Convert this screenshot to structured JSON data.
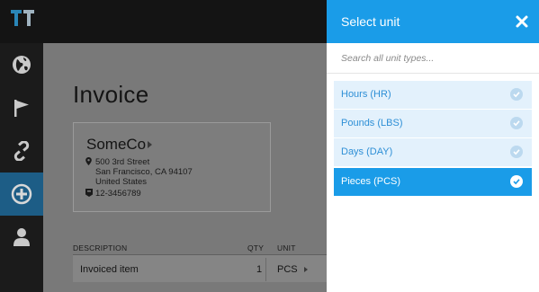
{
  "app": {
    "invoice_title": "Invoice",
    "company": {
      "name": "SomeCo",
      "address_lines": [
        "500 3rd Street",
        "San Francisco, CA 94107",
        "United States"
      ],
      "phone": "12-3456789"
    },
    "table": {
      "headers": [
        "DESCRIPTION",
        "QTY",
        "UNIT"
      ],
      "rows": [
        {
          "description": "Invoiced item",
          "qty": "1",
          "unit": "PCS"
        }
      ]
    },
    "nav": [
      "globe-icon",
      "flag-icon",
      "link-icon",
      "add-icon",
      "user-icon"
    ]
  },
  "panel": {
    "title": "Select unit",
    "search_placeholder": "Search all unit types...",
    "options": [
      {
        "label": "Hours (HR)",
        "selected": false
      },
      {
        "label": "Pounds (LBS)",
        "selected": false
      },
      {
        "label": "Days (DAY)",
        "selected": false
      },
      {
        "label": "Pieces (PCS)",
        "selected": true
      }
    ]
  },
  "colors": {
    "accent": "#1a9ce8",
    "option_bg": "#e3f1fc",
    "option_text": "#2e8fd6",
    "topbar": "#141414",
    "sidebar": "#1b1b1b",
    "nav_active": "#1d5d86"
  }
}
